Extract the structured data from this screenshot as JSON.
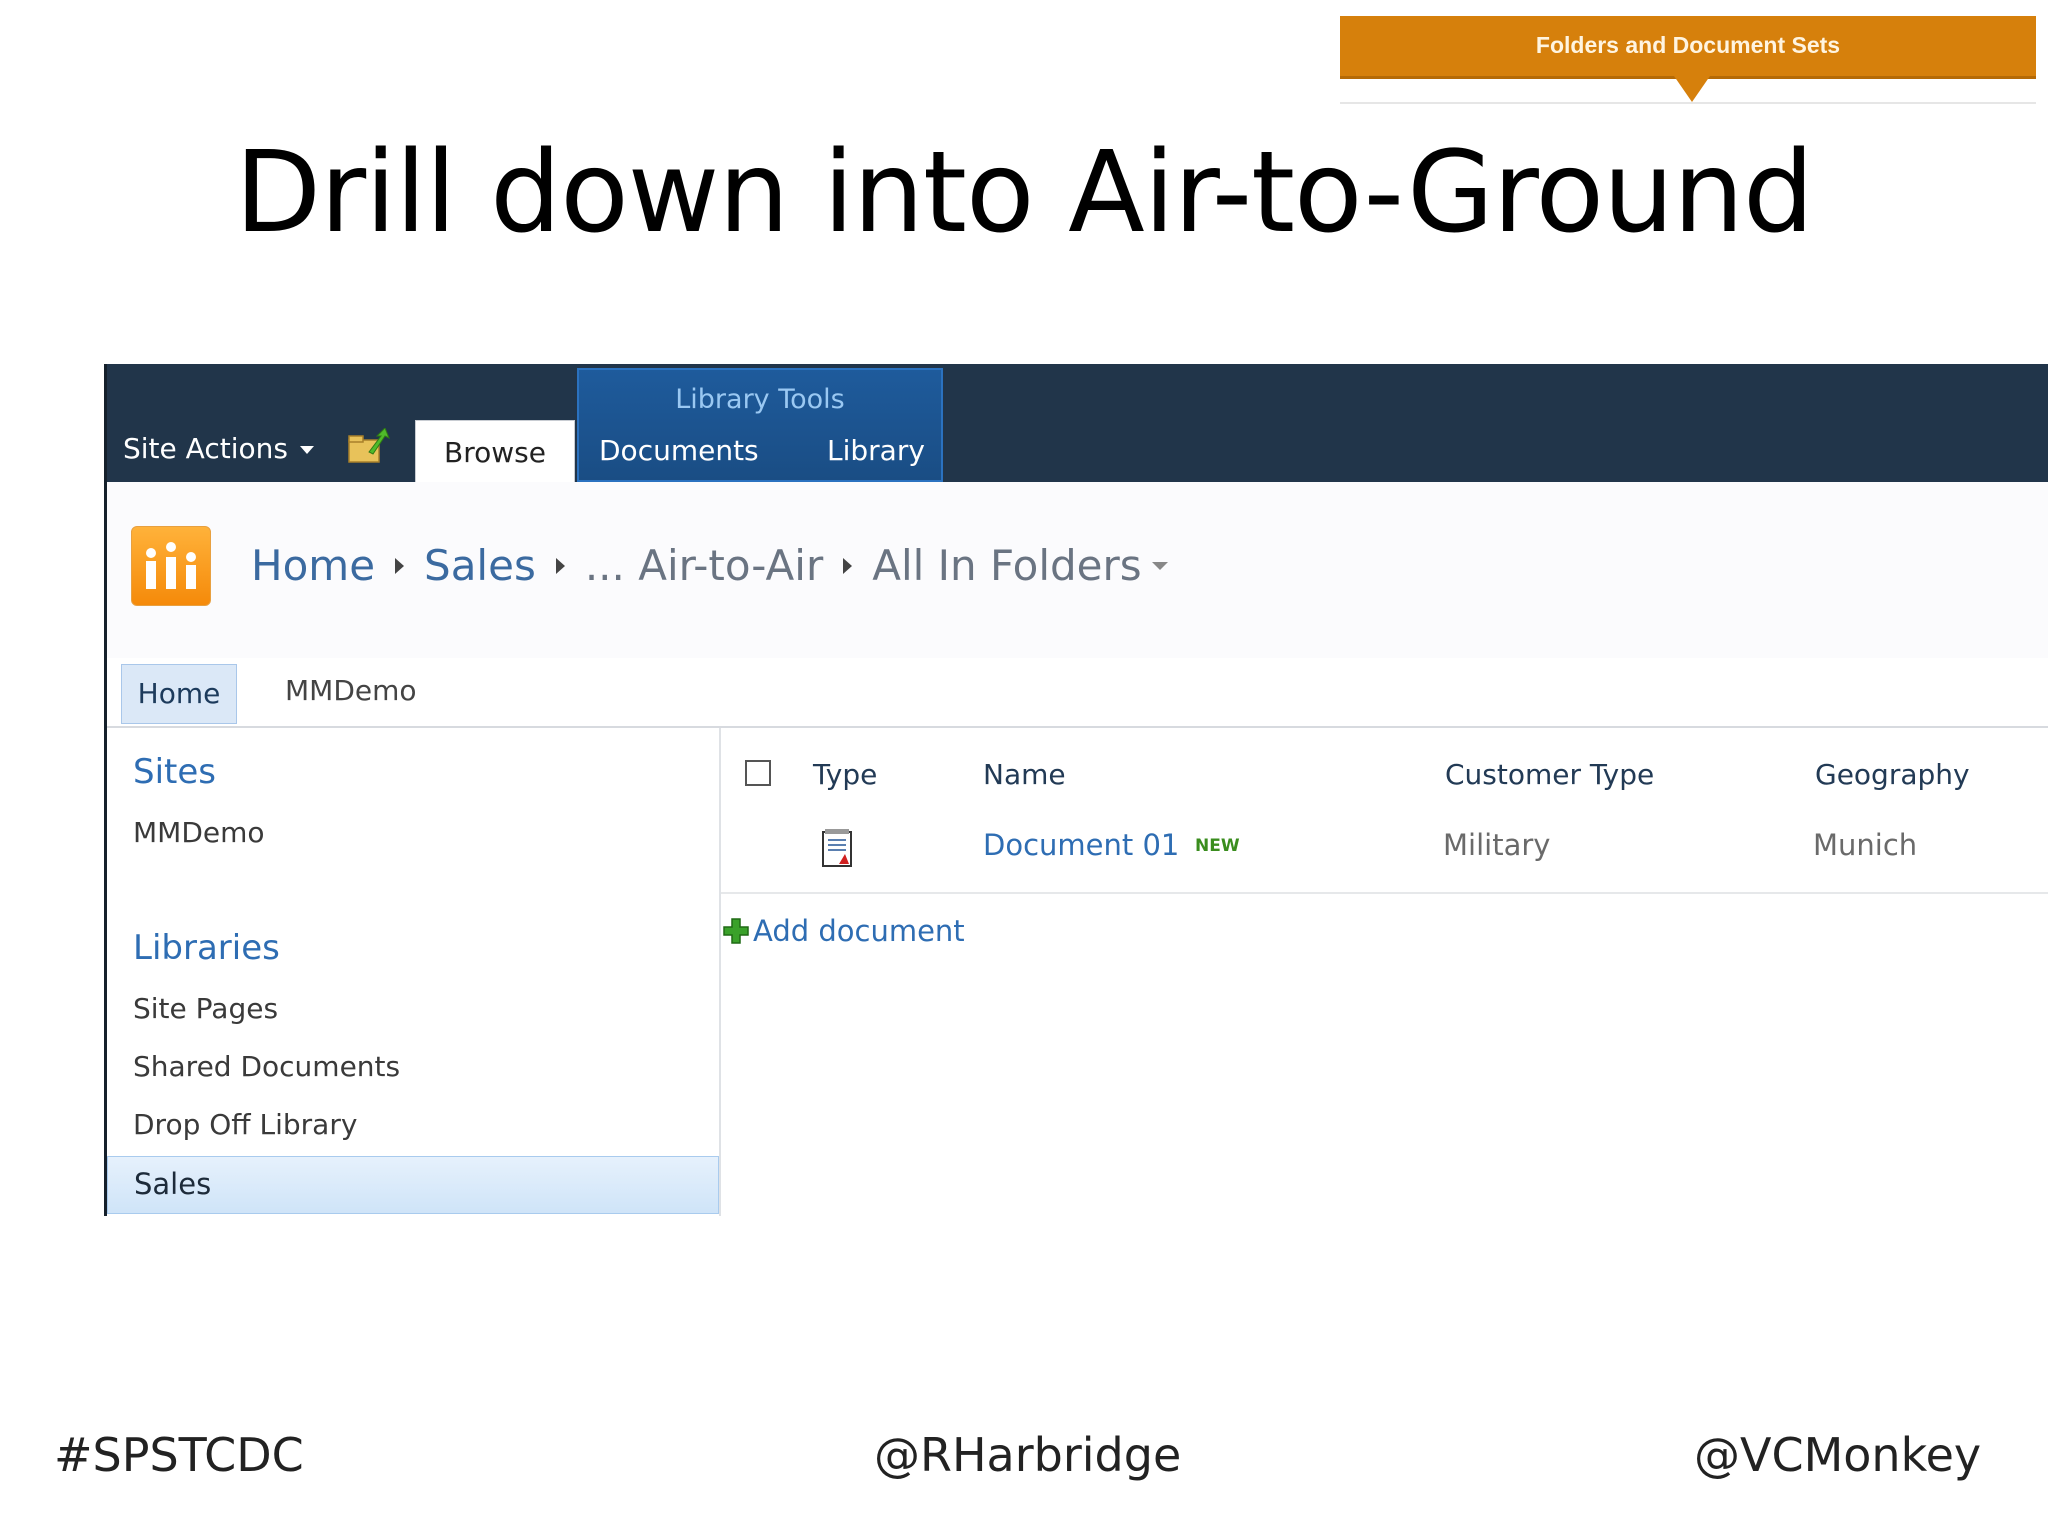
{
  "banner": {
    "label": "Folders and Document Sets"
  },
  "slide": {
    "title": "Drill down into Air-to-Ground"
  },
  "ribbon": {
    "site_actions": "Site Actions",
    "tab_browse": "Browse",
    "library_tools": "Library Tools",
    "tab_documents": "Documents",
    "tab_library": "Library"
  },
  "breadcrumb": {
    "home": "Home",
    "sales": "Sales",
    "folder": "... Air-to-Air",
    "view": "All In Folders"
  },
  "topnav": {
    "home": "Home",
    "mmdemo": "MMDemo"
  },
  "quicklaunch": {
    "sites_heading": "Sites",
    "sites_item": "MMDemo",
    "libraries_heading": "Libraries",
    "items": [
      "Site Pages",
      "Shared Documents",
      "Drop Off Library"
    ],
    "selected": "Sales"
  },
  "list": {
    "headers": {
      "type": "Type",
      "name": "Name",
      "customer_type": "Customer Type",
      "geography": "Geography"
    },
    "rows": [
      {
        "name": "Document 01",
        "badge": "NEW",
        "customer_type": "Military",
        "geography": "Munich"
      }
    ],
    "add_document": "Add document"
  },
  "footer": {
    "left": "#SPSTCDC",
    "center": "@RHarbridge",
    "right": "@VCMonkey"
  },
  "colors": {
    "ribbon": "#21354a",
    "accent_orange": "#d6800c",
    "link_blue": "#2e6db3"
  }
}
